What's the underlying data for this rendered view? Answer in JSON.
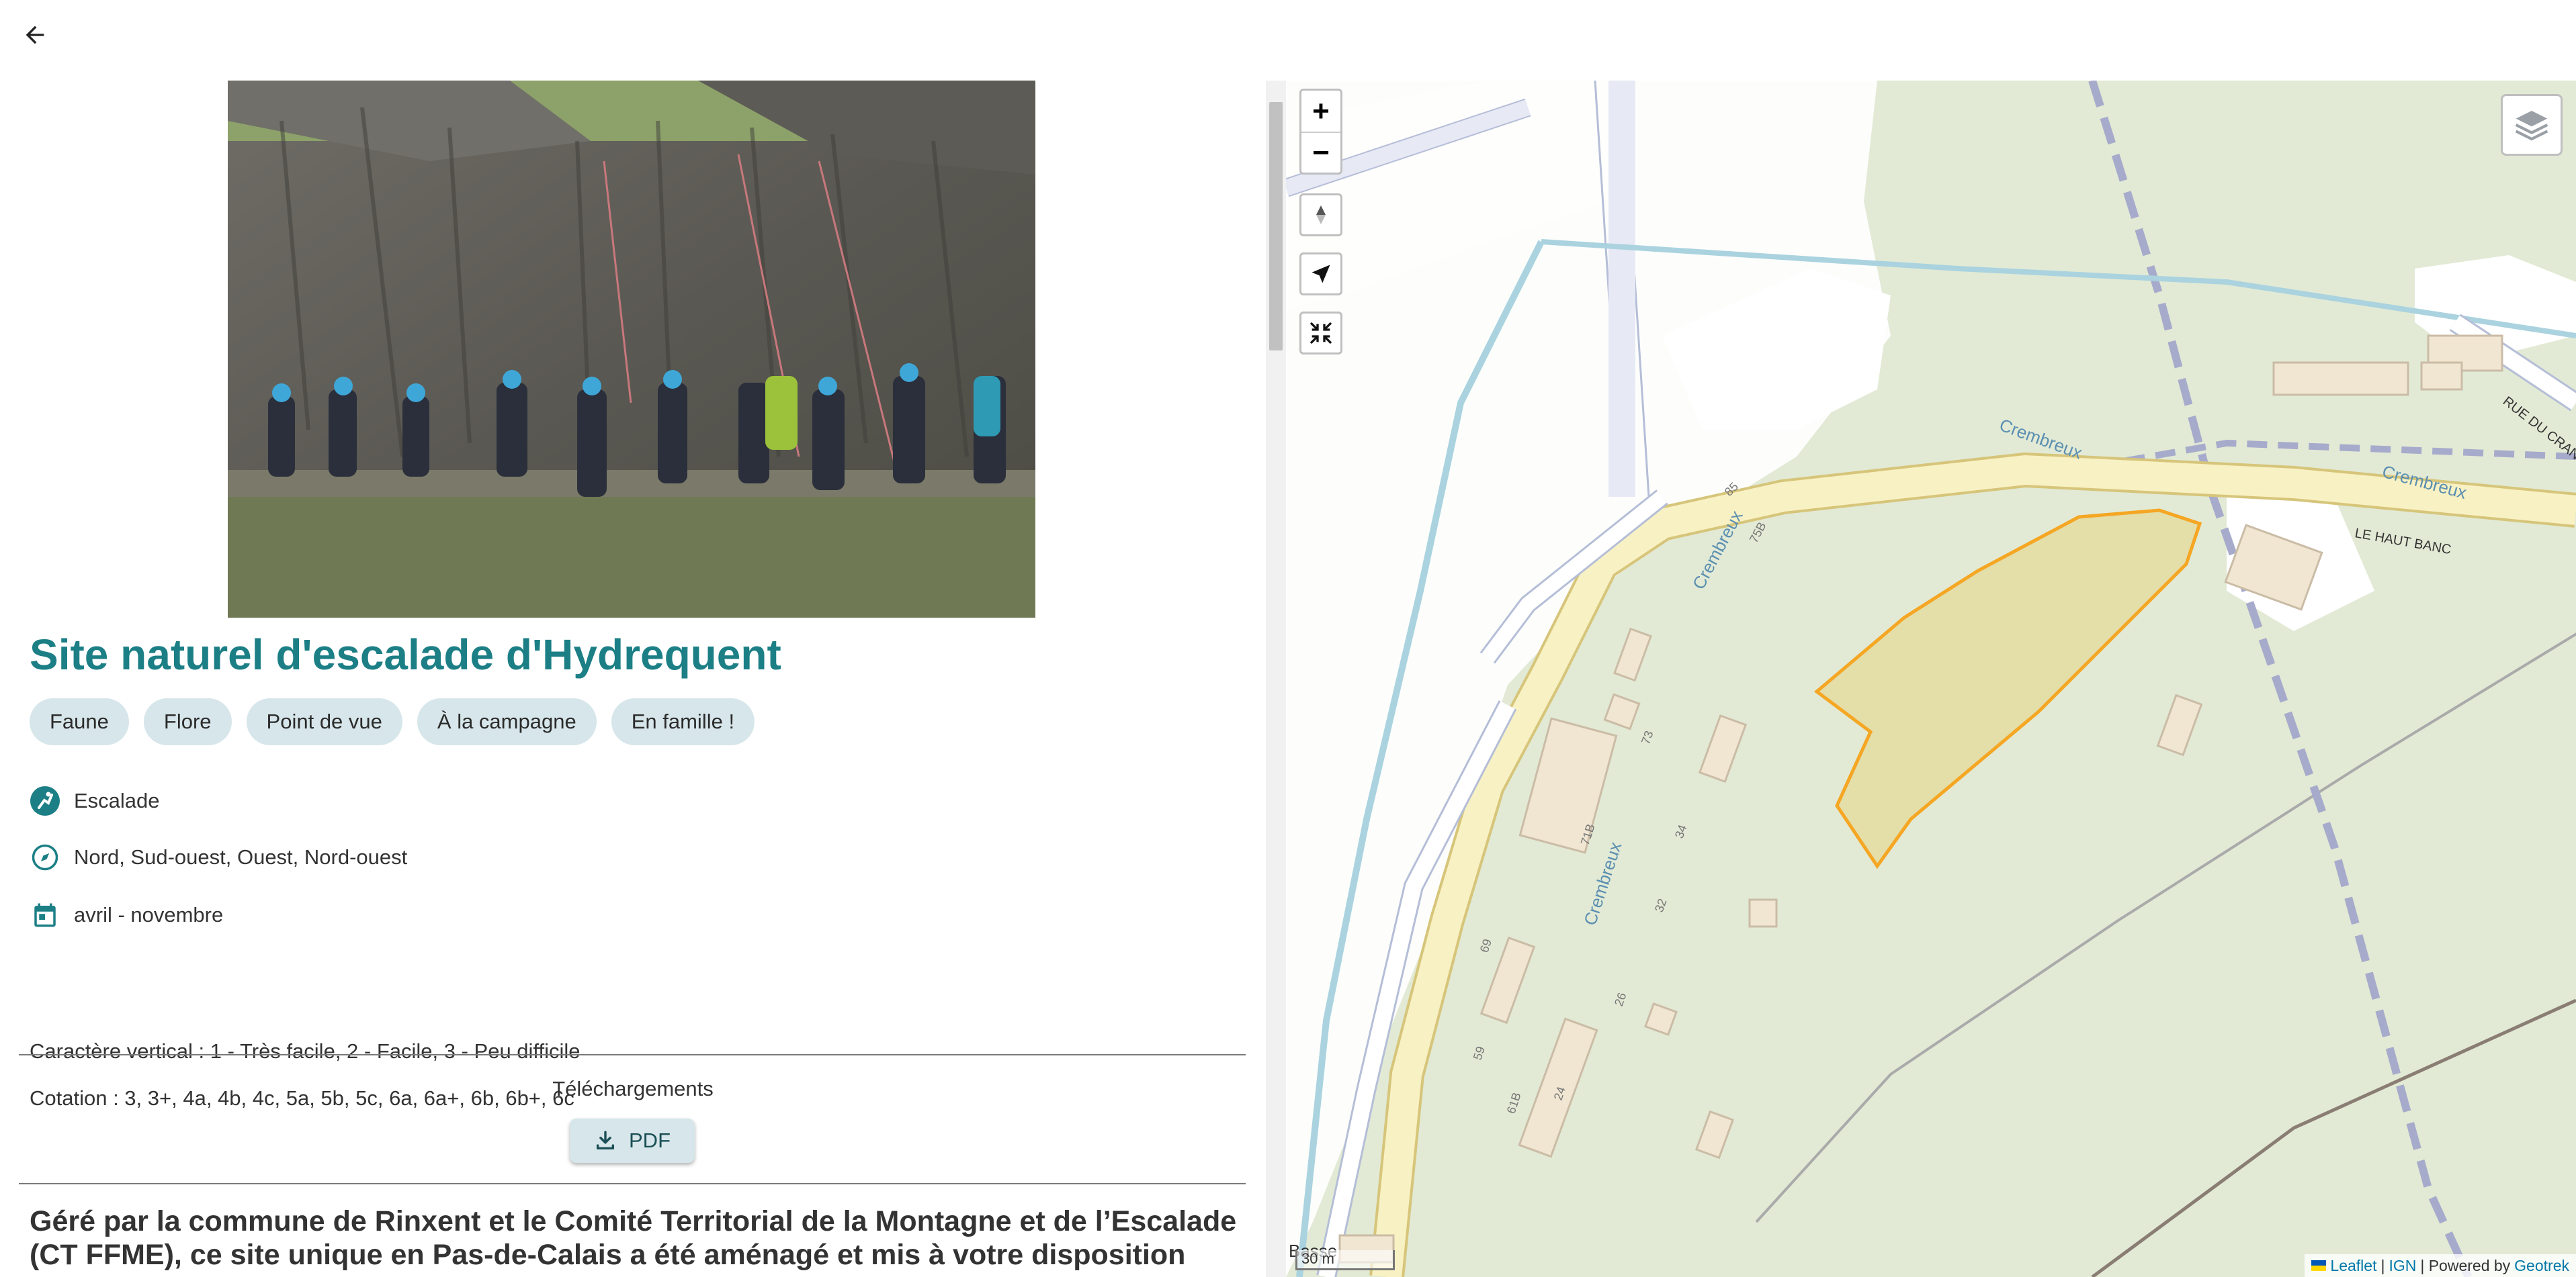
{
  "header": {
    "back_icon": "arrow-left-icon"
  },
  "site": {
    "title": "Site naturel d'escalade d'Hydrequent",
    "photo_alt": "Groupe de grimpeurs casqués au pied d'une falaise calcaire",
    "tags": [
      "Faune",
      "Flore",
      "Point de vue",
      "À la campagne",
      "En famille !"
    ],
    "practice": "Escalade",
    "orientation": "Nord, Sud-ouest, Ouest, Nord-ouest",
    "period": "avril - novembre",
    "vertical": "Caractère vertical : 1 - Très facile, 2 - Facile, 3 - Peu difficile",
    "grades": "Cotation : 3, 3+, 4a, 4b, 4c, 5a, 5b, 5c, 6a, 6a+, 6b, 6b+, 6c",
    "downloads_title": "Téléchargements",
    "pdf_label": "PDF",
    "description": "Géré par la commune de Rinxent et le Comité Territorial de la Montagne et de l’Escalade (CT FFME), ce site unique en Pas-de-Calais a été aménagé et mis à votre disposition"
  },
  "map": {
    "zoom_in": "+",
    "zoom_out": "−",
    "scale": "30 m",
    "attribution": {
      "leaflet": "Leaflet",
      "sep1": "|",
      "ign": "IGN",
      "sep2": "| Powered by",
      "geotrek": "Geotrek"
    },
    "labels": {
      "stream": "Crembreux",
      "road_haut_banc": "LE HAUT BANC",
      "road_rue": "RUE DU CRAN",
      "place": "Basse",
      "n85": "85",
      "n75b": "75B",
      "n73": "73",
      "n71b": "71B",
      "n34": "34",
      "n32": "32",
      "n26": "26",
      "n24": "24",
      "n69": "69",
      "n59": "59",
      "n61b": "61B"
    },
    "colors": {
      "site_fill": "#e4d99a",
      "site_stroke": "#f5a623",
      "road": "#f8f1c3",
      "water": "#aad3df"
    }
  }
}
